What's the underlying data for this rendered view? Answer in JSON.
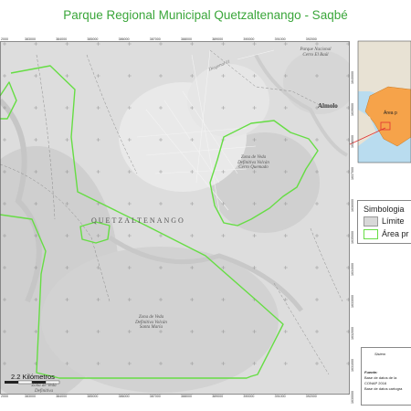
{
  "title": "Parque Regional Municipal Quetzaltenango - Saqbé",
  "labels": {
    "city": "QUETZALTENANGO",
    "town": "Almolo",
    "road": "Diagonal 11",
    "zones": [
      "Zona de Veda Definitiva Volcán Cerro Quemado",
      "Zona de Veda Definitiva Volcán Santa María",
      "Zona de Veda Definitiva",
      "Parque Nacional Cerro El Baúl"
    ]
  },
  "grid": {
    "top_ticks": [
      "2000",
      "383000",
      "384000",
      "385000",
      "386000",
      "387000",
      "388000",
      "389000",
      "390000",
      "391000",
      "392000"
    ],
    "bottom_ticks": [
      "2000",
      "383000",
      "384000",
      "385000",
      "386000",
      "387000",
      "388000",
      "389000",
      "390000",
      "391000",
      "392000"
    ],
    "right_ticks": [
      "1640000",
      "1639000",
      "1638000",
      "1637000",
      "1636000",
      "1635000",
      "1634000",
      "1633000",
      "1632000",
      "1631000",
      "1630000"
    ]
  },
  "legend": {
    "title": "Simbologia",
    "items": [
      {
        "label": "Límite",
        "color": "#d8d8d8"
      },
      {
        "label": "Área pr",
        "color": "#66dd44"
      }
    ]
  },
  "inset": {
    "label": "Área p"
  },
  "scale": {
    "label": "2.2 Kilómetros"
  },
  "info_box": {
    "header": "Sistem",
    "source_title": "Fuente:",
    "lines": [
      "Base de datos de la",
      "CONAP 2016",
      "Base de datos cartogra"
    ]
  },
  "colors": {
    "boundary": "#66dd44",
    "terrain": "#dcdcdc",
    "inset_country": "#f6a34a",
    "inset_sea": "#b9dcef",
    "marker": "#e03030"
  }
}
